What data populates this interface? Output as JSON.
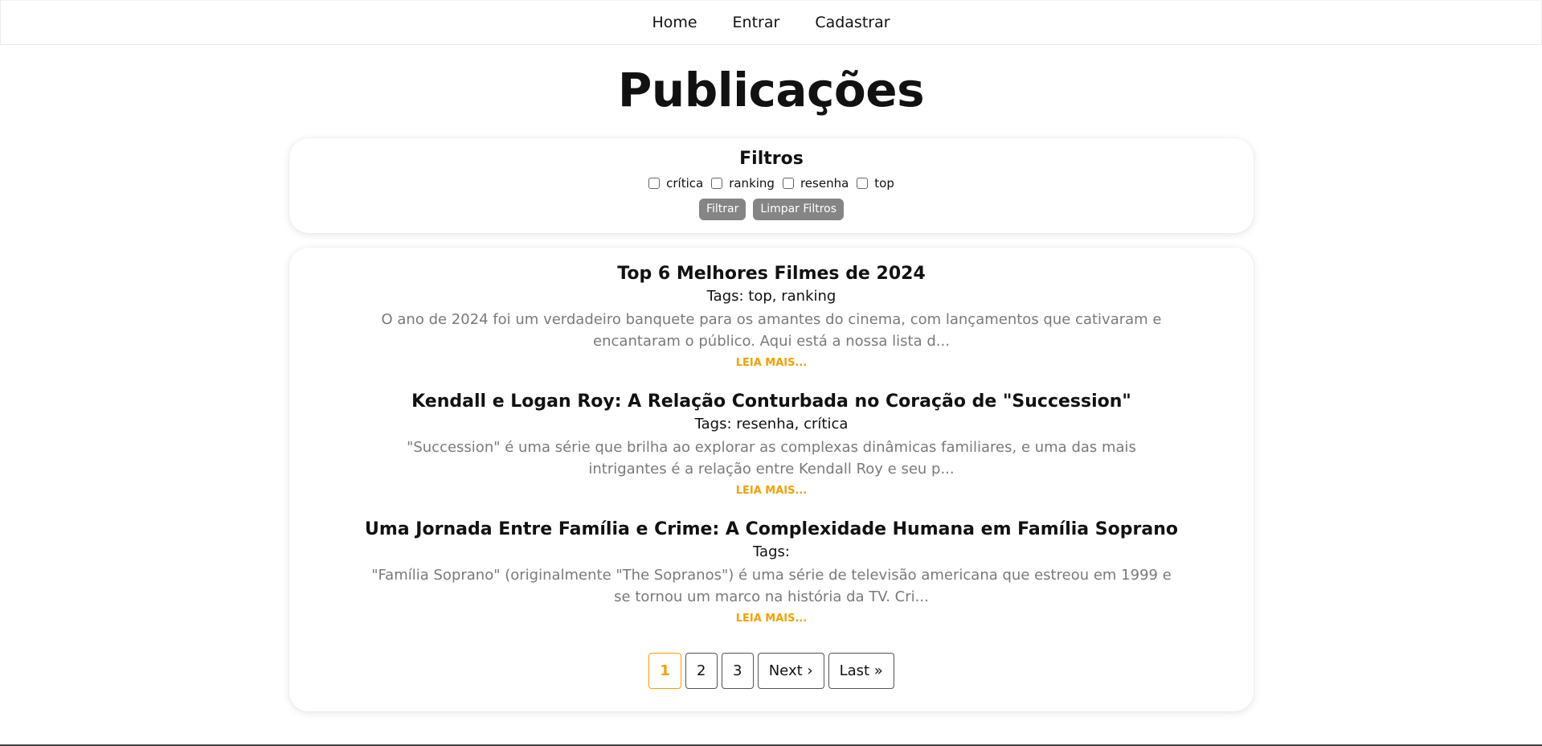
{
  "nav": {
    "items": [
      {
        "label": "Home"
      },
      {
        "label": "Entrar"
      },
      {
        "label": "Cadastrar"
      }
    ]
  },
  "page": {
    "title": "Publicações"
  },
  "filters": {
    "title": "Filtros",
    "options": [
      {
        "label": "crítica",
        "checked": false
      },
      {
        "label": "ranking",
        "checked": false
      },
      {
        "label": "resenha",
        "checked": false
      },
      {
        "label": "top",
        "checked": false
      }
    ],
    "filter_button": "Filtrar",
    "clear_button": "Limpar Filtros"
  },
  "posts": [
    {
      "title": "Top 6 Melhores Filmes de 2024",
      "tags": "Tags: top, ranking",
      "excerpt": "O ano de 2024 foi um verdadeiro banquete para os amantes do cinema, com lançamentos que cativaram e encantaram o público. Aqui está a nossa lista d...",
      "read_more": "LEIA MAIS..."
    },
    {
      "title": "Kendall e Logan Roy: A Relação Conturbada no Coração de \"Succession\"",
      "tags": "Tags: resenha, crítica",
      "excerpt": "\"Succession\" é uma série que brilha ao explorar as complexas dinâmicas familiares, e uma das mais intrigantes é a relação entre Kendall Roy e seu p...",
      "read_more": "LEIA MAIS..."
    },
    {
      "title": "Uma Jornada Entre Família e Crime: A Complexidade Humana em Família Soprano",
      "tags": "Tags:",
      "excerpt": "\"Família Soprano\" (originalmente \"The Sopranos\") é uma série de televisão americana que estreou em 1999 e se tornou um marco na história da TV. Cri...",
      "read_more": "LEIA MAIS..."
    }
  ],
  "pagination": {
    "pages": [
      "1",
      "2",
      "3"
    ],
    "current": "1",
    "next": "Next ›",
    "last": "Last »"
  },
  "colors": {
    "accent": "#f2a100",
    "excerpt": "#7a7a7a",
    "button_bg": "#858585"
  }
}
